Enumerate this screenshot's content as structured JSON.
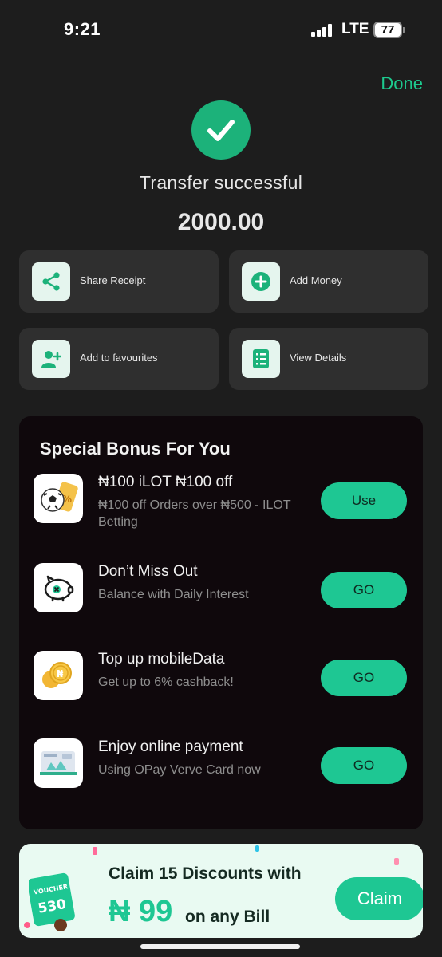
{
  "status_bar": {
    "time": "9:21",
    "network": "LTE",
    "battery": "77"
  },
  "header": {
    "done_label": "Done"
  },
  "result": {
    "title": "Transfer successful",
    "amount": "2000.00"
  },
  "actions": [
    {
      "label": "Share Receipt",
      "icon": "share-icon"
    },
    {
      "label": "Add Money",
      "icon": "plus-circle-icon"
    },
    {
      "label": "Add to favourites",
      "icon": "add-user-icon"
    },
    {
      "label": "View Details",
      "icon": "document-list-icon"
    }
  ],
  "bonus": {
    "title": "Special Bonus For You",
    "offers": [
      {
        "title": "₦100 iLOT ₦100 off",
        "subtitle": "₦100 off Orders over ₦500 - ILOT Betting",
        "button": "Use",
        "icon": "soccer-ball-ticket-icon"
      },
      {
        "title": "Don’t Miss Out",
        "subtitle": "Balance with Daily Interest",
        "button": "GO",
        "icon": "piggy-bank-icon"
      },
      {
        "title": "Top up mobileData",
        "subtitle": "Get up to 6% cashback!",
        "button": "GO",
        "icon": "gold-coins-icon"
      },
      {
        "title": "Enjoy online payment",
        "subtitle": "Using OPay Verve Card now",
        "button": "GO",
        "icon": "verve-card-icon"
      }
    ]
  },
  "banner": {
    "line1": "Claim 15 Discounts with",
    "price": "₦ 99",
    "line2": "on any Bill",
    "button": "Claim",
    "voucher_label": "VOUCHER",
    "voucher_value": "530"
  },
  "colors": {
    "accent": "#1ec793",
    "background": "#1d1d1d",
    "card": "#2f2f2f",
    "bonus_panel": "#0f080c"
  }
}
